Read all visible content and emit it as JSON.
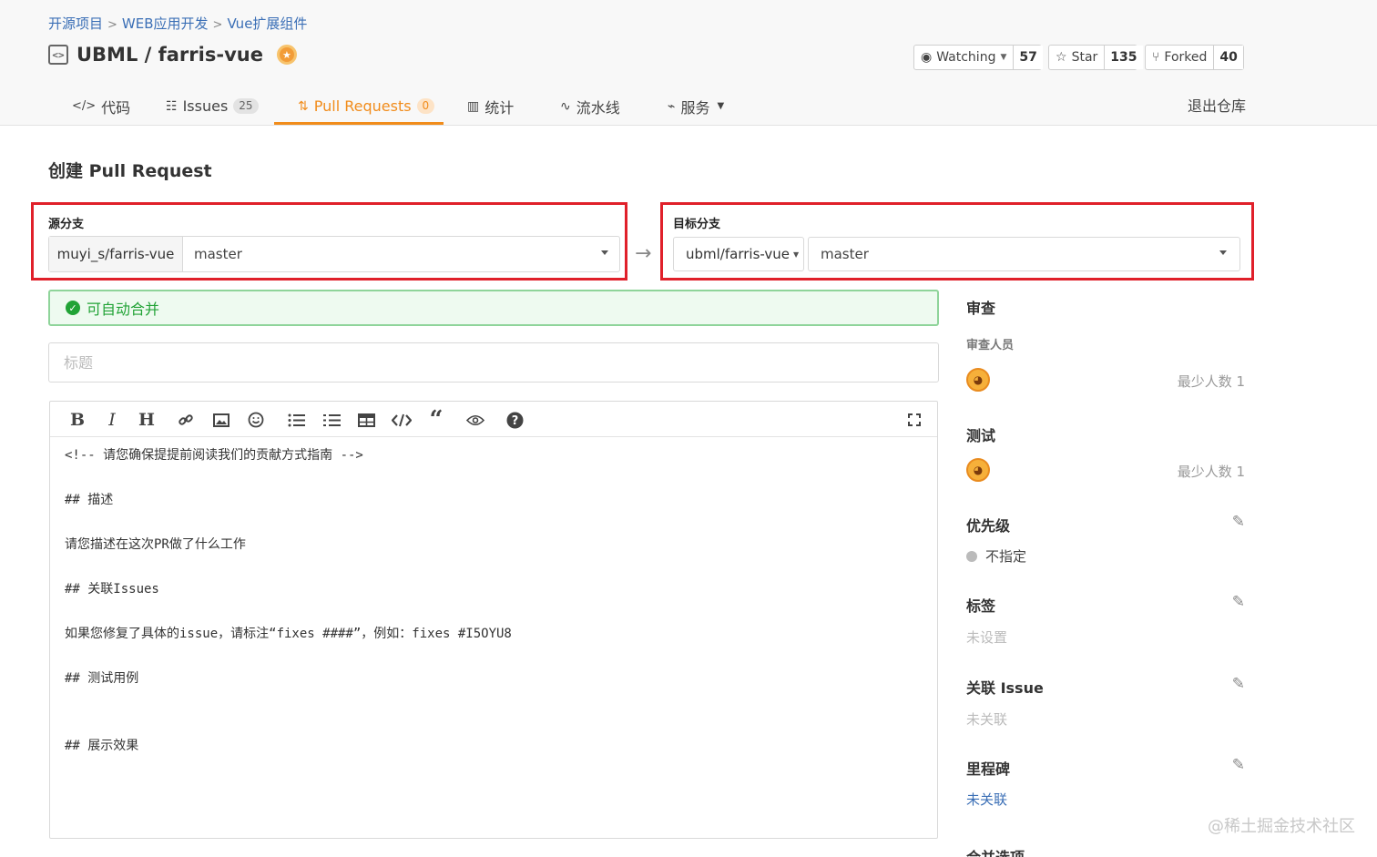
{
  "breadcrumb": [
    "开源项目",
    "WEB应用开发",
    "Vue扩展组件"
  ],
  "breadcrumb_sep": ">",
  "repo": {
    "title": "UBML / farris-vue",
    "icon": "repo-code-icon",
    "badge_icon": "award-badge-icon"
  },
  "actions": {
    "watch": {
      "label": "Watching",
      "count": "57",
      "icon": "eye-icon"
    },
    "star": {
      "label": "Star",
      "count": "135",
      "icon": "star-icon"
    },
    "fork": {
      "label": "Forked",
      "count": "40",
      "icon": "fork-icon"
    }
  },
  "tabs": [
    {
      "label": "代码",
      "icon": "code-icon"
    },
    {
      "label": "Issues",
      "count": "25",
      "icon": "issues-icon"
    },
    {
      "label": "Pull Requests",
      "count": "0",
      "icon": "pull-request-icon",
      "active": true
    },
    {
      "label": "统计",
      "icon": "bar-chart-icon"
    },
    {
      "label": "流水线",
      "icon": "pipeline-icon"
    },
    {
      "label": "服务",
      "icon": "pulse-icon"
    }
  ],
  "exit_label": "退出仓库",
  "page_title": "创建 Pull Request",
  "source": {
    "label": "源分支",
    "owner": "muyi_s/farris-vue",
    "branch": "master"
  },
  "target": {
    "label": "目标分支",
    "owner": "ubml/farris-vue",
    "branch": "master"
  },
  "arrow": "→",
  "merge_status": "可自动合并",
  "title_input": {
    "placeholder": "标题",
    "value": ""
  },
  "toolbar_buttons": [
    "bold",
    "italic",
    "heading",
    "link",
    "image",
    "emoji",
    "bullet-list",
    "numbered-list",
    "table",
    "code",
    "quote",
    "preview",
    "help",
    "fullscreen"
  ],
  "editor_lines": [
    "<!-- 请您确保提提前阅读我们的贡献方式指南 -->",
    "",
    "## 描述",
    "",
    "请您描述在这次PR做了什么工作",
    "",
    "## 关联Issues",
    "",
    "如果您修复了具体的issue，请标注“fixes ####”，例如：fixes #I5OYU8",
    "",
    "## 测试用例",
    "",
    "",
    "## 展示效果"
  ],
  "sidebar": {
    "review": {
      "title": "审查",
      "sub": "审查人员",
      "min": "最少人数 1"
    },
    "test": {
      "title": "测试",
      "min": "最少人数 1"
    },
    "priority": {
      "title": "优先级",
      "value": "不指定"
    },
    "labels": {
      "title": "标签",
      "value": "未设置"
    },
    "issue": {
      "title": "关联 Issue",
      "value": "未关联"
    },
    "milestone": {
      "title": "里程碑",
      "value": "未关联"
    },
    "merge_options": {
      "title": "合并选项"
    }
  },
  "watermark": "@稀土掘金技术社区",
  "colors": {
    "accent": "#f18c1b",
    "link": "#3b6fb6",
    "success": "#21a336",
    "highlight_box": "#e0202a"
  }
}
